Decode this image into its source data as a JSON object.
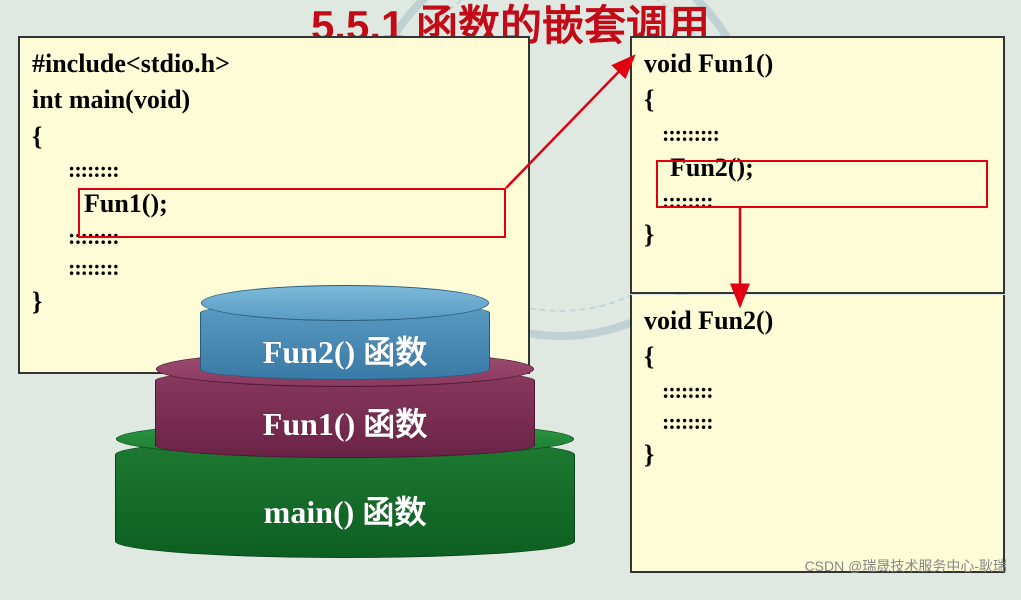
{
  "title": "5.5.1 函数的嵌套调用",
  "main_box": {
    "l1": "#include<stdio.h>",
    "l2": "int main(void)",
    "l3": "{",
    "l4": "        ::::::::",
    "l5": "        Fun1();",
    "l6": "        ::::::::",
    "l7": "        ::::::::",
    "l8": "}"
  },
  "fun1_box": {
    "l1": "void Fun1()",
    "l2": "{",
    "l3": "    :::::::::",
    "l4": "    Fun2();",
    "l5": "    ::::::::",
    "l6": "}"
  },
  "fun2_box": {
    "l1": "void Fun2()",
    "l2": "{",
    "l3": "    ::::::::",
    "l4": "    ::::::::",
    "l5": "}"
  },
  "stack": {
    "top": "Fun2() 函数",
    "mid": "Fun1() 函数",
    "bottom": "main() 函数"
  },
  "watermark": "CSDN @瑞晟技术服务中心-耿瑞"
}
